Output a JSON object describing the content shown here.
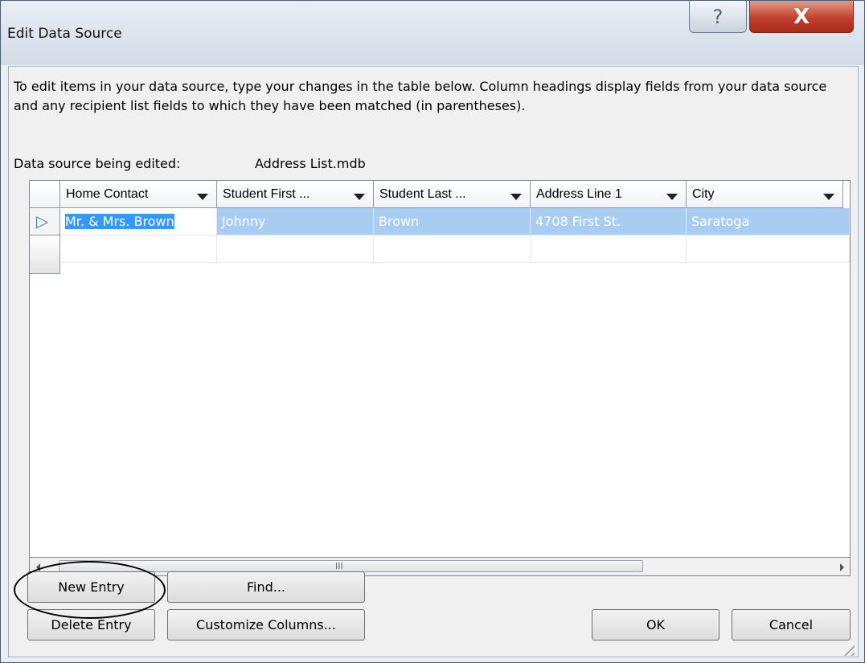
{
  "window": {
    "title": "Edit Data Source",
    "help_label": "?",
    "close_label": "X"
  },
  "instructions": "To edit items in your data source, type your changes in the table below. Column headings display fields from your data source and any recipient list fields to which they have been matched (in parentheses).",
  "data_source": {
    "label": "Data source being edited:",
    "value": "Address List.mdb"
  },
  "grid": {
    "columns": [
      "Home Contact",
      "Student First ...",
      "Student Last ...",
      "Address Line 1",
      "City"
    ],
    "rows": [
      [
        "Mr. & Mrs. Brown",
        "Johnny",
        "Brown",
        "4708 First St.",
        "Saratoga"
      ],
      [
        "",
        "",
        "",
        "",
        ""
      ]
    ],
    "current_row_indicator": "▷",
    "scroll_grip": "III"
  },
  "buttons": {
    "new_entry": "New Entry",
    "find": "Find...",
    "delete_entry": "Delete Entry",
    "customize_columns": "Customize Columns...",
    "ok": "OK",
    "cancel": "Cancel"
  },
  "colors": {
    "selection": "#a8cdf1",
    "edit_highlight": "#3399ff",
    "close_button": "#c2402d"
  }
}
